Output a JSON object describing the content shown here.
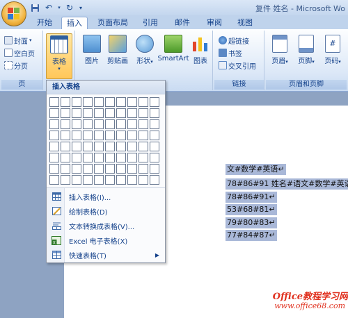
{
  "window": {
    "title": "复件 姓名 - Microsoft Wo"
  },
  "tabs": [
    "开始",
    "插入",
    "页面布局",
    "引用",
    "邮件",
    "审阅",
    "视图"
  ],
  "active_tab": "插入",
  "ribbon": {
    "pages": {
      "cover": "封面",
      "blank": "空白页",
      "break": "分页",
      "label": "页"
    },
    "table_btn": "表格",
    "illustrations": {
      "picture": "图片",
      "clipart": "剪贴画",
      "shapes": "形状",
      "smartart": "SmartArt",
      "chart": "图表"
    },
    "links": {
      "hyperlink": "超链接",
      "bookmark": "书签",
      "crossref": "交叉引用",
      "label": "链接"
    },
    "header_footer": {
      "header": "页眉",
      "footer": "页脚",
      "page_number": "页码",
      "label": "页眉和页脚"
    }
  },
  "dropdown": {
    "header": "插入表格",
    "grid_cols": 10,
    "grid_rows": 8,
    "items": [
      {
        "label": "插入表格(I)...",
        "icon": "insert-table-icon"
      },
      {
        "label": "绘制表格(D)",
        "icon": "draw-table-icon"
      },
      {
        "label": "文本转换成表格(V)...",
        "icon": "text-to-table-icon"
      },
      {
        "label": "Excel 电子表格(X)",
        "icon": "excel-icon"
      },
      {
        "label": "快速表格(T)",
        "icon": "quick-table-icon",
        "submenu": true
      }
    ]
  },
  "document": {
    "lines": [
      "文#数学#英语↵",
      "78#86#91 姓名#语文#数学#英语↵",
      "78#86#91↵",
      "53#68#81↵",
      "79#80#83↵",
      "77#84#87↵"
    ]
  },
  "watermark": {
    "brand": "Office教程学习网",
    "url": "www.office68.com"
  },
  "colors": {
    "accent": "#15428b",
    "ribbon": "#dce8f7",
    "highlight": "#a9b8d8",
    "watermark": "#e0301e"
  }
}
